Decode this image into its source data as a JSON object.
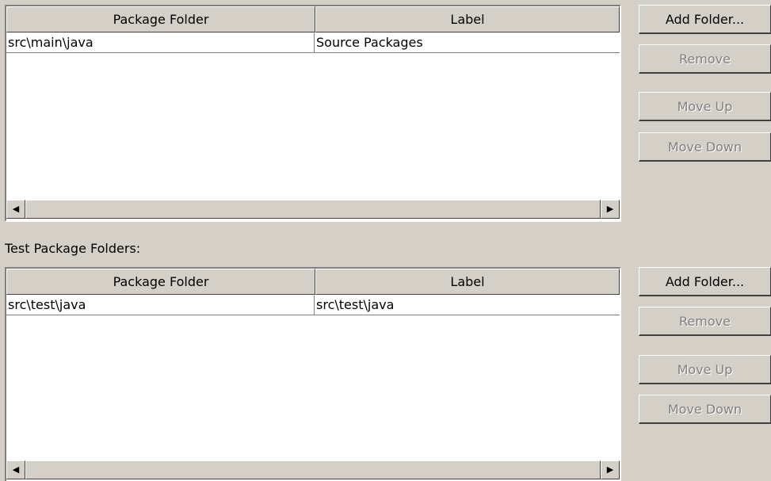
{
  "source_panel": {
    "columns": [
      "Package Folder",
      "Label"
    ],
    "rows": [
      {
        "folder": "src\\main\\java",
        "label": "Source Packages"
      }
    ],
    "buttons": {
      "add": "Add Folder...",
      "remove": "Remove",
      "move_up": "Move Up",
      "move_down": "Move Down"
    }
  },
  "test_panel": {
    "title": "Test Package Folders:",
    "columns": [
      "Package Folder",
      "Label"
    ],
    "rows": [
      {
        "folder": "src\\test\\java",
        "label": "src\\test\\java"
      }
    ],
    "buttons": {
      "add": "Add Folder...",
      "remove": "Remove",
      "move_up": "Move Up",
      "move_down": "Move Down"
    }
  },
  "icons": {
    "scroll_left": "◀",
    "scroll_right": "▶"
  }
}
